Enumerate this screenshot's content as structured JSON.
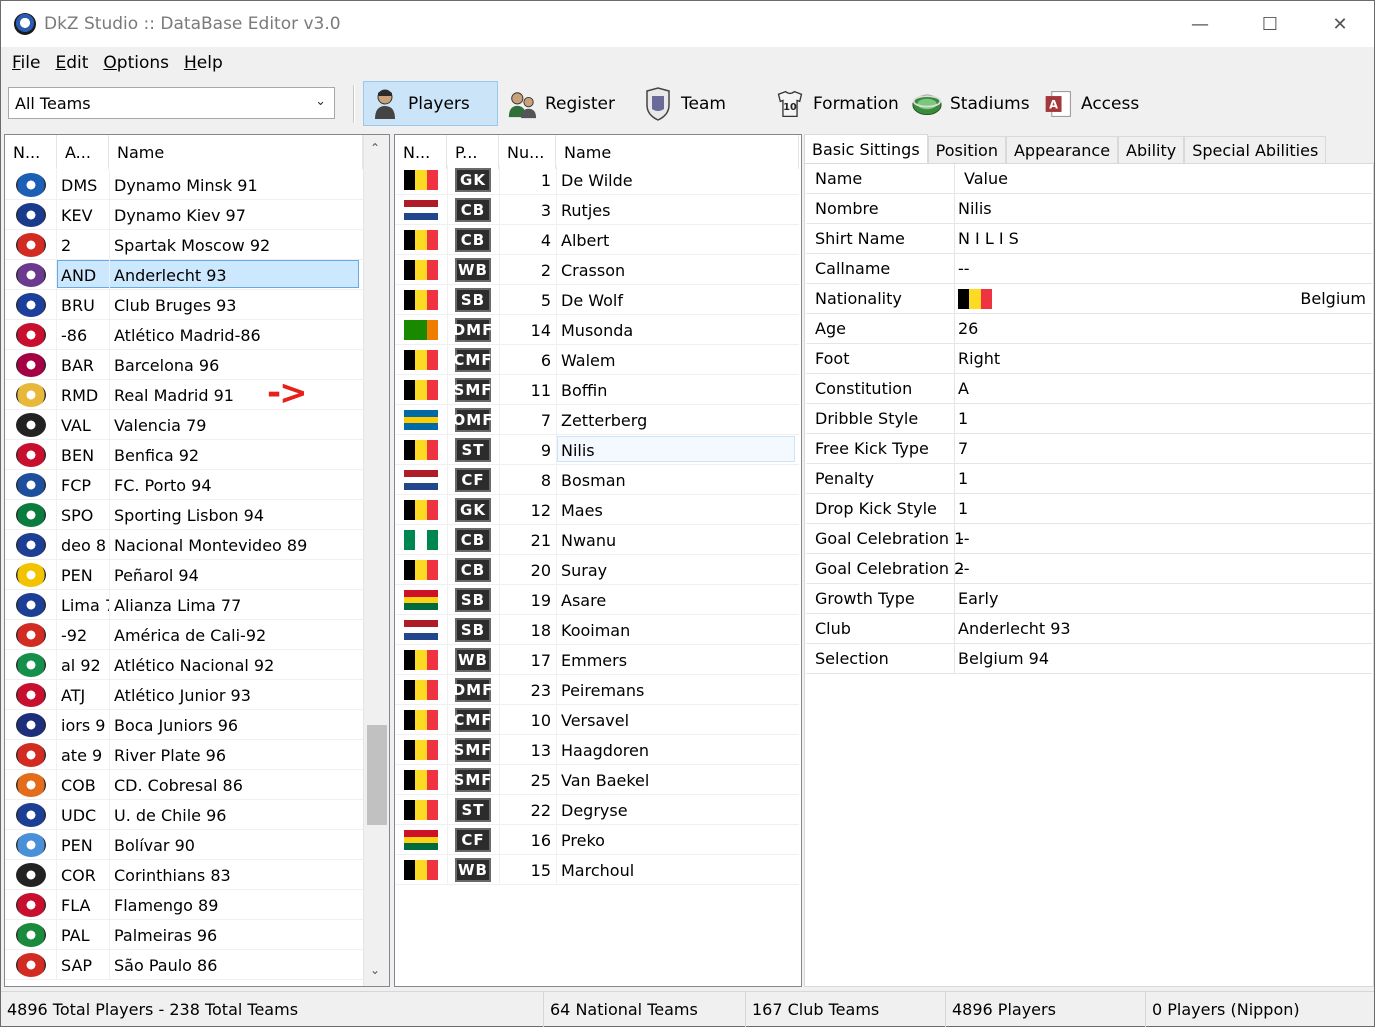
{
  "window": {
    "title": "DkZ Studio :: DataBase Editor v3.0"
  },
  "menu": [
    {
      "key": "F",
      "rest": "ile"
    },
    {
      "key": "E",
      "rest": "dit"
    },
    {
      "key": "O",
      "rest": "ptions"
    },
    {
      "key": "H",
      "rest": "elp"
    }
  ],
  "toolbar": {
    "team_filter": "All Teams",
    "buttons": [
      {
        "label": "Players",
        "icon": "player-icon",
        "active": true
      },
      {
        "label": "Register",
        "icon": "register-icon",
        "active": false
      },
      {
        "label": "Team",
        "icon": "team-icon",
        "active": false
      },
      {
        "label": "Formation",
        "icon": "formation-icon",
        "active": false
      },
      {
        "label": "Stadiums",
        "icon": "stadium-icon",
        "active": false
      },
      {
        "label": "Access",
        "icon": "access-icon",
        "active": false
      }
    ]
  },
  "teams": {
    "headers": [
      "N...",
      "A...",
      "Name"
    ],
    "rows": [
      {
        "abbr": "DMS",
        "name": "Dynamo Minsk 91",
        "color": "#1c5fb5"
      },
      {
        "abbr": "KEV",
        "name": "Dynamo Kiev 97",
        "color": "#1a3b8c"
      },
      {
        "abbr": "2",
        "name": "Spartak Moscow 92",
        "color": "#d22b22"
      },
      {
        "abbr": "AND",
        "name": "Anderlecht 93",
        "color": "#6b3a8e",
        "selected": true
      },
      {
        "abbr": "BRU",
        "name": "Club Bruges 93",
        "color": "#1b3f9a"
      },
      {
        "abbr": "-86",
        "name": "Atlético Madrid-86",
        "color": "#c8102e"
      },
      {
        "abbr": "BAR",
        "name": "Barcelona 96",
        "color": "#a50044"
      },
      {
        "abbr": "RMD",
        "name": "Real Madrid 91",
        "color": "#e8b83a"
      },
      {
        "abbr": "VAL",
        "name": "Valencia 79",
        "color": "#222222"
      },
      {
        "abbr": "BEN",
        "name": "Benfica 92",
        "color": "#c8102e"
      },
      {
        "abbr": "FCP",
        "name": "FC. Porto 94",
        "color": "#1d4f9c"
      },
      {
        "abbr": "SPO",
        "name": "Sporting Lisbon 94",
        "color": "#0a7d3e"
      },
      {
        "abbr": "deo 8",
        "name": "Nacional Montevideo 89",
        "color": "#1c3f95"
      },
      {
        "abbr": "PEN",
        "name": "Peñarol 94",
        "color": "#f4c300"
      },
      {
        "abbr": "Lima 7",
        "name": "Alianza Lima 77",
        "color": "#1c3f95"
      },
      {
        "abbr": "-92",
        "name": "América de Cali-92",
        "color": "#d22b22"
      },
      {
        "abbr": "al 92",
        "name": "Atlético Nacional 92",
        "color": "#15904a"
      },
      {
        "abbr": "ATJ",
        "name": "Atlético Junior 93",
        "color": "#c8102e"
      },
      {
        "abbr": "iors 9",
        "name": "Boca Juniors 96",
        "color": "#1c2f7a"
      },
      {
        "abbr": "ate 9",
        "name": "River Plate 96",
        "color": "#d22b22"
      },
      {
        "abbr": "COB",
        "name": "CD. Cobresal 86",
        "color": "#e46d1b"
      },
      {
        "abbr": "UDC",
        "name": "U. de Chile 96",
        "color": "#1c3f95"
      },
      {
        "abbr": "PEN",
        "name": "Bolívar 90",
        "color": "#4a90d9"
      },
      {
        "abbr": "COR",
        "name": "Corinthians 83",
        "color": "#222222"
      },
      {
        "abbr": "FLA",
        "name": "Flamengo 89",
        "color": "#c8102e"
      },
      {
        "abbr": "PAL",
        "name": "Palmeiras 96",
        "color": "#1a8a3c"
      },
      {
        "abbr": "SAP",
        "name": "São Paulo 86",
        "color": "#d22b22"
      }
    ]
  },
  "players": {
    "headers": [
      "N...",
      "P...",
      "Nu...",
      "Name"
    ],
    "rows": [
      {
        "flag": [
          "#000000",
          "#fdda24",
          "#ef3340"
        ],
        "flag_dir": "v",
        "pos": "GK",
        "num": "1",
        "name": "De Wilde"
      },
      {
        "flag": [
          "#ae1c28",
          "#ffffff",
          "#21468b"
        ],
        "flag_dir": "h",
        "pos": "CB",
        "num": "3",
        "name": "Rutjes"
      },
      {
        "flag": [
          "#000000",
          "#fdda24",
          "#ef3340"
        ],
        "flag_dir": "v",
        "pos": "CB",
        "num": "4",
        "name": "Albert"
      },
      {
        "flag": [
          "#000000",
          "#fdda24",
          "#ef3340"
        ],
        "flag_dir": "v",
        "pos": "WB",
        "num": "2",
        "name": "Crasson"
      },
      {
        "flag": [
          "#000000",
          "#fdda24",
          "#ef3340"
        ],
        "flag_dir": "v",
        "pos": "SB",
        "num": "5",
        "name": "De Wolf"
      },
      {
        "flag": [
          "#198a00",
          "#198a00",
          "#ef7d00"
        ],
        "flag_dir": "v",
        "pos": "DMF",
        "num": "14",
        "name": "Musonda"
      },
      {
        "flag": [
          "#000000",
          "#fdda24",
          "#ef3340"
        ],
        "flag_dir": "v",
        "pos": "CMF",
        "num": "6",
        "name": "Walem"
      },
      {
        "flag": [
          "#000000",
          "#fdda24",
          "#ef3340"
        ],
        "flag_dir": "v",
        "pos": "SMF",
        "num": "11",
        "name": "Boffin"
      },
      {
        "flag": [
          "#006aa7",
          "#fecc00",
          "#006aa7"
        ],
        "flag_dir": "h",
        "pos": "OMF",
        "num": "7",
        "name": "Zetterberg"
      },
      {
        "flag": [
          "#000000",
          "#fdda24",
          "#ef3340"
        ],
        "flag_dir": "v",
        "pos": "ST",
        "num": "9",
        "name": "Nilis",
        "selected": true
      },
      {
        "flag": [
          "#ae1c28",
          "#ffffff",
          "#21468b"
        ],
        "flag_dir": "h",
        "pos": "CF",
        "num": "8",
        "name": "Bosman"
      },
      {
        "flag": [
          "#000000",
          "#fdda24",
          "#ef3340"
        ],
        "flag_dir": "v",
        "pos": "GK",
        "num": "12",
        "name": "Maes"
      },
      {
        "flag": [
          "#008751",
          "#ffffff",
          "#008751"
        ],
        "flag_dir": "v",
        "pos": "CB",
        "num": "21",
        "name": "Nwanu"
      },
      {
        "flag": [
          "#000000",
          "#fdda24",
          "#ef3340"
        ],
        "flag_dir": "v",
        "pos": "CB",
        "num": "20",
        "name": "Suray"
      },
      {
        "flag": [
          "#ce1126",
          "#fcd116",
          "#006b3f"
        ],
        "flag_dir": "h",
        "pos": "SB",
        "num": "19",
        "name": "Asare"
      },
      {
        "flag": [
          "#ae1c28",
          "#ffffff",
          "#21468b"
        ],
        "flag_dir": "h",
        "pos": "SB",
        "num": "18",
        "name": "Kooiman"
      },
      {
        "flag": [
          "#000000",
          "#fdda24",
          "#ef3340"
        ],
        "flag_dir": "v",
        "pos": "WB",
        "num": "17",
        "name": "Emmers"
      },
      {
        "flag": [
          "#000000",
          "#fdda24",
          "#ef3340"
        ],
        "flag_dir": "v",
        "pos": "DMF",
        "num": "23",
        "name": "Peiremans"
      },
      {
        "flag": [
          "#000000",
          "#fdda24",
          "#ef3340"
        ],
        "flag_dir": "v",
        "pos": "CMF",
        "num": "10",
        "name": "Versavel"
      },
      {
        "flag": [
          "#000000",
          "#fdda24",
          "#ef3340"
        ],
        "flag_dir": "v",
        "pos": "SMF",
        "num": "13",
        "name": "Haagdoren"
      },
      {
        "flag": [
          "#000000",
          "#fdda24",
          "#ef3340"
        ],
        "flag_dir": "v",
        "pos": "SMF",
        "num": "25",
        "name": "Van Baekel"
      },
      {
        "flag": [
          "#000000",
          "#fdda24",
          "#ef3340"
        ],
        "flag_dir": "v",
        "pos": "ST",
        "num": "22",
        "name": "Degryse"
      },
      {
        "flag": [
          "#ce1126",
          "#fcd116",
          "#006b3f"
        ],
        "flag_dir": "h",
        "pos": "CF",
        "num": "16",
        "name": "Preko"
      },
      {
        "flag": [
          "#000000",
          "#fdda24",
          "#ef3340"
        ],
        "flag_dir": "v",
        "pos": "WB",
        "num": "15",
        "name": "Marchoul"
      }
    ]
  },
  "detail": {
    "tabs": [
      {
        "label": "Basic Sittings",
        "active": true
      },
      {
        "label": "Position"
      },
      {
        "label": "Appearance"
      },
      {
        "label": "Ability"
      },
      {
        "label": "Special Abilities"
      }
    ],
    "header": {
      "name": "Name",
      "value": "Value"
    },
    "props": [
      {
        "key": "Nombre",
        "value": "Nilis"
      },
      {
        "key": "Shirt Name",
        "value": "N I L I S"
      },
      {
        "key": "Callname",
        "value": "--"
      },
      {
        "key": "Nationality",
        "value": "Belgium",
        "flag": [
          "#000000",
          "#fdda24",
          "#ef3340"
        ]
      },
      {
        "key": "Age",
        "value": "26"
      },
      {
        "key": "Foot",
        "value": "Right"
      },
      {
        "key": "Constitution",
        "value": "A"
      },
      {
        "key": "Dribble Style",
        "value": "1"
      },
      {
        "key": "Free Kick Type",
        "value": "7"
      },
      {
        "key": "Penalty",
        "value": "1"
      },
      {
        "key": "Drop Kick Style",
        "value": "1"
      },
      {
        "key": "Goal Celebration 1",
        "value": "--"
      },
      {
        "key": "Goal Celebration 2",
        "value": "--"
      },
      {
        "key": "Growth Type",
        "value": "Early"
      },
      {
        "key": "Club",
        "value": "Anderlecht 93"
      },
      {
        "key": "Selection",
        "value": "Belgium 94"
      }
    ]
  },
  "status": [
    "4896 Total Players  -  238 Total Teams",
    "64 National Teams",
    "167 Club Teams",
    "4896 Players",
    "0 Players (Nippon)"
  ],
  "annotation_arrow": "->"
}
